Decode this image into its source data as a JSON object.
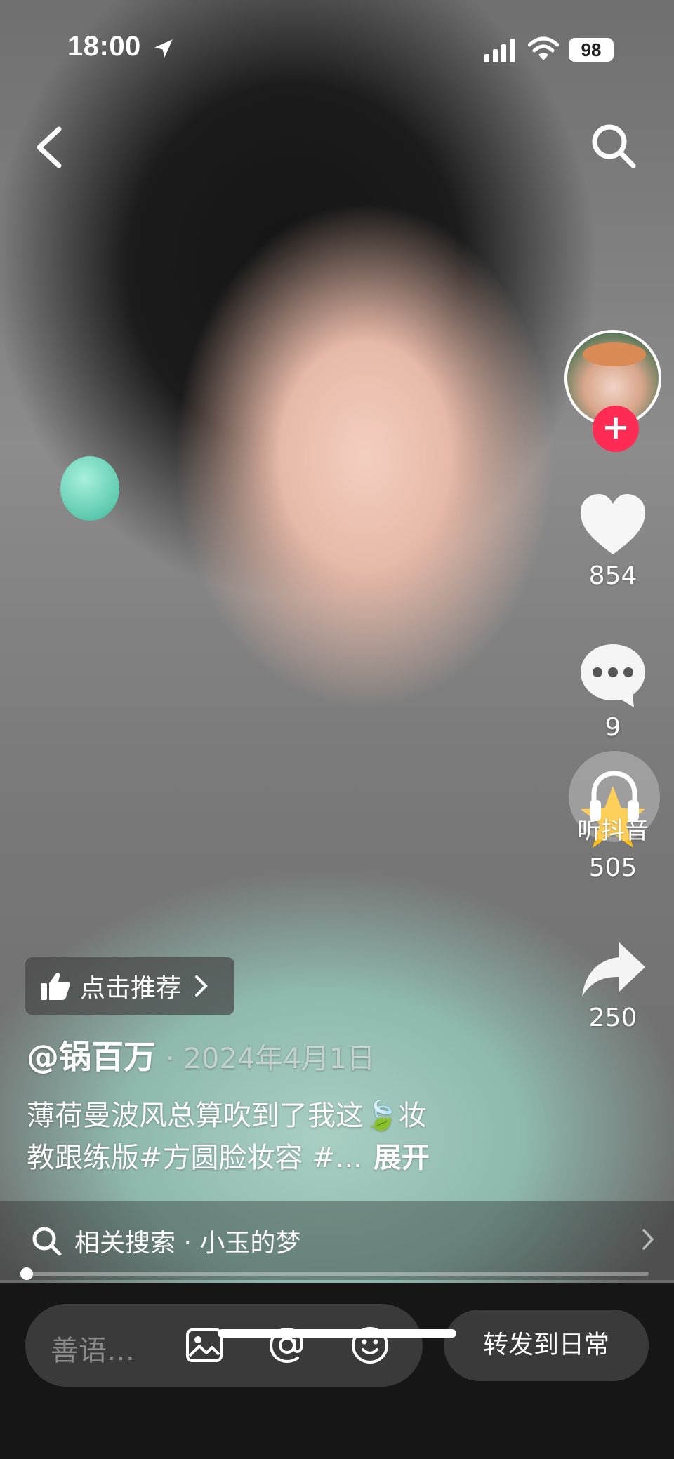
{
  "status_bar": {
    "time": "18:00",
    "battery": "98"
  },
  "rail": {
    "like_count": "854",
    "comment_count": "9",
    "favorite_count": "505",
    "share_count": "250",
    "listen_label": "听抖音"
  },
  "recommend": {
    "label": "点击推荐"
  },
  "post": {
    "author": "@锅百万",
    "date": "· 2024年4月1日",
    "caption_line1": "薄荷曼波风总算吹到了我这🍃妆",
    "caption_line2": "教跟练版#方圆脸妆容 #...",
    "expand": "展开"
  },
  "related_search": {
    "text": "相关搜索 · 小玉的梦"
  },
  "progress": {
    "played_fraction": 0.0
  },
  "bottom_bar": {
    "comment_placeholder": "善语…",
    "forward_label": "转发到日常"
  },
  "colors": {
    "accent": "#fe2c55",
    "favorite": "#ffbe1a"
  }
}
